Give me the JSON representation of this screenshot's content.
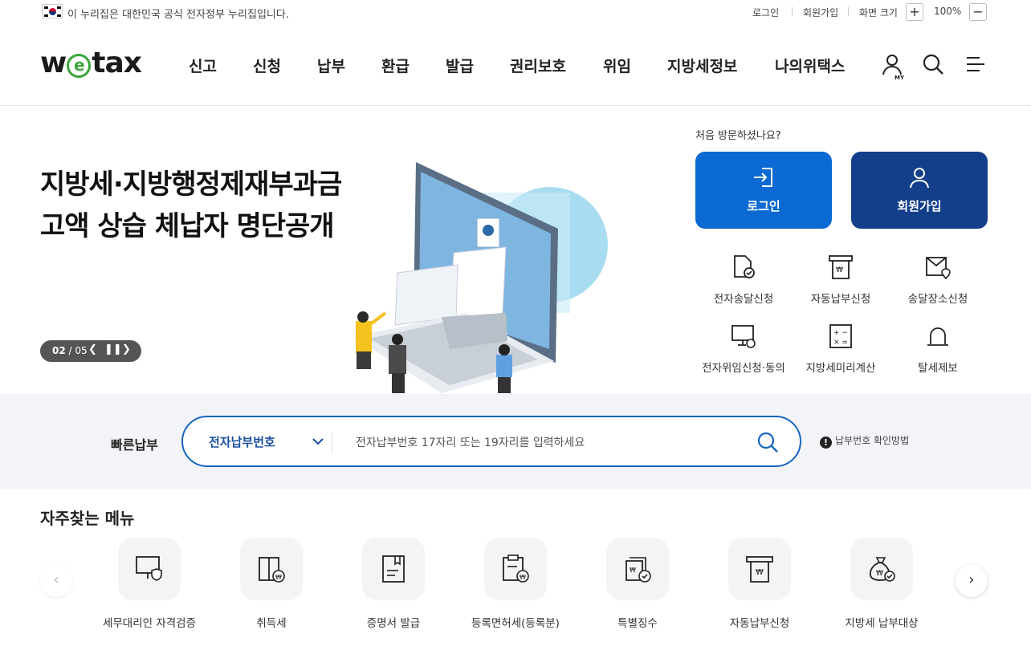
{
  "gov_banner": {
    "text": "이 누리집은 대한민국 공식 전자정부 누리집입니다."
  },
  "util": {
    "login": "로그인",
    "join": "회원가입",
    "zoom_label": "화면 크기",
    "zoom_plus": "+",
    "zoom_value": "100%",
    "zoom_minus": "−"
  },
  "logo": {
    "pre": "w",
    "e": "e",
    "post": "tax"
  },
  "gnb": [
    "신고",
    "신청",
    "납부",
    "환급",
    "발급",
    "권리보호",
    "위임",
    "지방세정보",
    "나의위택스"
  ],
  "header_icons": {
    "my": "MY"
  },
  "hero": {
    "title_line1": "지방세·지방행정제재부과금",
    "title_line2": "고액 상습 체납자 명단공개",
    "slide_current": "02",
    "slide_sep": " / ",
    "slide_total": "05"
  },
  "side": {
    "first_visit": "처음 방문하셨나요?",
    "login_btn": "로그인",
    "join_btn": "회원가입",
    "quick": [
      "전자송달신청",
      "자동납부신청",
      "송달장소신청",
      "전자위임신청·동의",
      "지방세미리계산",
      "탈세제보"
    ]
  },
  "quickpay": {
    "title": "빠른납부",
    "select": "전자납부번호",
    "placeholder": "전자납부번호 17자리 또는 19자리를 입력하세요",
    "help": "납부번호 확인방법",
    "help_icon": "!"
  },
  "favorites": {
    "title": "자주찾는 메뉴",
    "items": [
      "세무대리인 자격검증",
      "취득세",
      "증명서 발급",
      "등록면허세(등록분)",
      "특별징수",
      "자동납부신청",
      "지방세 납부대상"
    ]
  },
  "colors": {
    "primary": "#0a69d2",
    "navy": "#133f8a",
    "logo_green": "#3aa53a"
  }
}
